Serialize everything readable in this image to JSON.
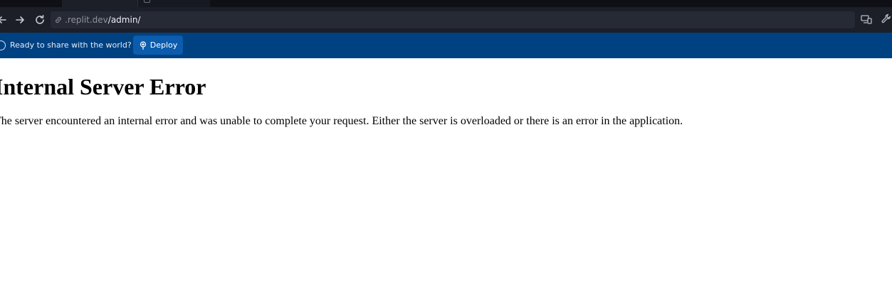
{
  "browser": {
    "url_host": ".replit.dev",
    "url_path": "/admin/",
    "icons": {
      "back": "arrow-left-icon",
      "forward": "arrow-right-icon",
      "reload": "reload-icon",
      "url": "link-icon",
      "right_1": "devices-icon",
      "right_2": "wrench-icon"
    }
  },
  "banner": {
    "message": "Ready to share with the world?",
    "deploy_label": "Deploy",
    "color": "#004182",
    "deploy_color": "#0b5cad"
  },
  "page": {
    "title": "Internal Server Error",
    "message": "The server encountered an internal error and was unable to complete your request. Either the server is overloaded or there is an error in the application."
  }
}
